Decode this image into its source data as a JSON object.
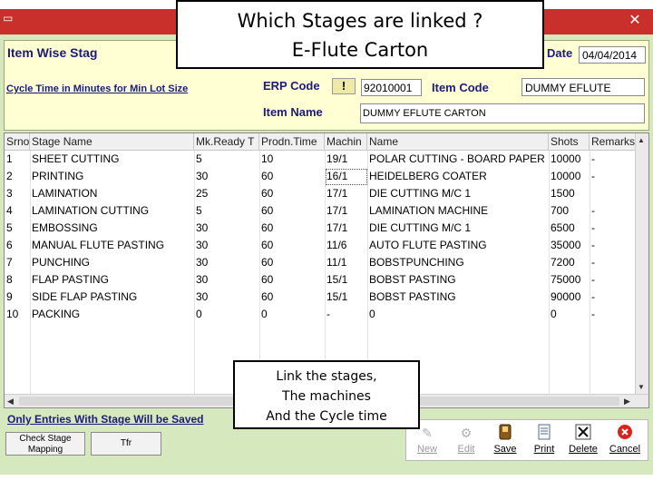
{
  "window": {
    "close_glyph": "✕"
  },
  "form": {
    "title": "Item Wise Stag",
    "date_label": "Date",
    "date_value": "04/04/2014",
    "cycle_label": "Cycle Time in Minutes for Min Lot Size",
    "erp_label": "ERP Code",
    "erp_warning": "!",
    "erp_value": "92010001",
    "item_code_label": "Item Code",
    "item_code_value": "DUMMY EFLUTE",
    "item_name_label": "Item Name",
    "item_name_value": "DUMMY EFLUTE CARTON"
  },
  "grid": {
    "columns": [
      "Srno",
      "Stage Name",
      "Mk.Ready T",
      "Prodn.Time",
      "Machin",
      "Name",
      "Shots",
      "Remarks"
    ],
    "rows": [
      [
        "1",
        "SHEET CUTTING",
        "5",
        "10",
        "19/1",
        "POLAR CUTTING - BOARD PAPER",
        "10000",
        "-"
      ],
      [
        "2",
        "PRINTING",
        "30",
        "60",
        "16/1",
        "HEIDELBERG COATER",
        "10000",
        "-"
      ],
      [
        "3",
        "LAMINATION",
        "25",
        "60",
        "17/1",
        "DIE CUTTING M/C 1",
        "1500",
        ""
      ],
      [
        "4",
        "LAMINATION CUTTING",
        "5",
        "60",
        "17/1",
        "LAMINATION MACHINE",
        "700",
        "-"
      ],
      [
        "5",
        "EMBOSSING",
        "30",
        "60",
        "17/1",
        "DIE CUTTING M/C 1",
        "6500",
        "-"
      ],
      [
        "6",
        "MANUAL FLUTE PASTING",
        "30",
        "60",
        "11/6",
        "AUTO FLUTE PASTING",
        "35000",
        "-"
      ],
      [
        "7",
        "PUNCHING",
        "30",
        "60",
        "11/1",
        "BOBSTPUNCHING",
        "7200",
        "-"
      ],
      [
        "8",
        "FLAP PASTING",
        "30",
        "60",
        "15/1",
        "BOBST PASTING",
        "75000",
        "-"
      ],
      [
        "9",
        "SIDE FLAP PASTING",
        "30",
        "60",
        "15/1",
        "BOBST PASTING",
        "90000",
        "-"
      ],
      [
        "10",
        "PACKING",
        "0",
        "0",
        "-",
        "0",
        "0",
        "-"
      ]
    ]
  },
  "footer": {
    "save_note": "Only Entries With Stage Will be Saved",
    "check_stage_line1": "Check Stage",
    "check_stage_line2": "Mapping",
    "tfr_label": "Tfr"
  },
  "toolbar": {
    "new_label": "New",
    "edit_label": "Edit",
    "save_label": "Save",
    "print_label": "Print",
    "delete_label": "Delete",
    "cancel_label": "Cancel"
  },
  "annotations": {
    "title_line1": "Which Stages are linked ?",
    "title_line2": "E-Flute Carton",
    "note_line1": "Link the stages,",
    "note_line2": "The machines",
    "note_line3": "And the Cycle time"
  },
  "colors": {
    "title_bar": "#c9302c",
    "form_background": "#d6e8bd",
    "header_panel": "#ffffd3",
    "label_text": "#1b1b7a"
  }
}
